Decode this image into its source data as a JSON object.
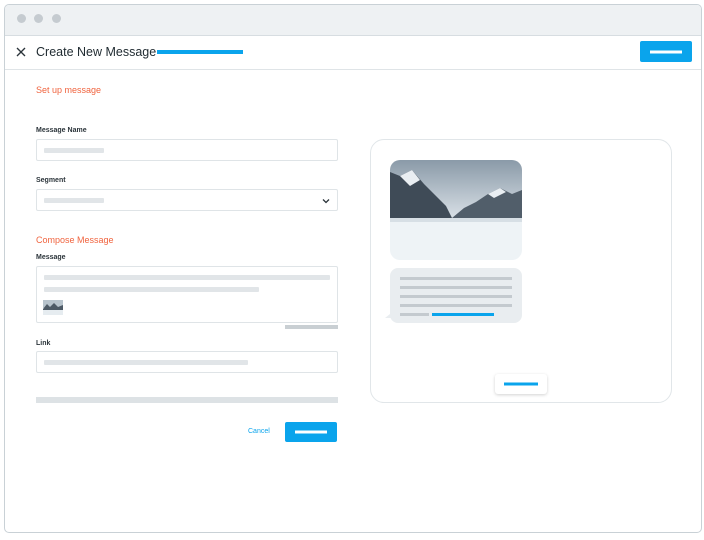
{
  "header": {
    "title": "Create New Message",
    "close_icon": "close-icon"
  },
  "setup": {
    "section_title": "Set up message",
    "message_name_label": "Message Name",
    "segment_label": "Segment"
  },
  "compose": {
    "section_title": "Compose Message",
    "message_label": "Message",
    "link_label": "Link"
  },
  "footer": {
    "cancel_label": "Cancel"
  },
  "colors": {
    "accent_blue": "#0aa4ec",
    "section_orange": "#f0643f",
    "placeholder_gray": "#e1e5e8"
  },
  "icons": {
    "close": "close-icon",
    "dropdown": "chevron-down-icon"
  }
}
